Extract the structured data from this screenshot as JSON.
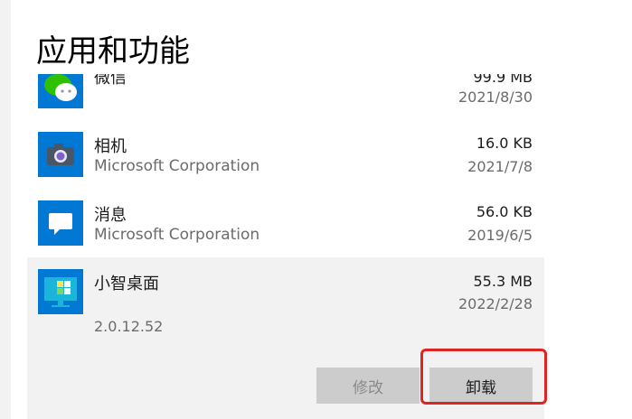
{
  "page": {
    "title": "应用和功能"
  },
  "apps": [
    {
      "name": "微信",
      "publisher": "",
      "size": "99.9 MB",
      "date": "2021/8/30",
      "icon": "wechat-icon"
    },
    {
      "name": "相机",
      "publisher": "Microsoft Corporation",
      "size": "16.0 KB",
      "date": "2021/7/8",
      "icon": "camera-icon"
    },
    {
      "name": "消息",
      "publisher": "Microsoft Corporation",
      "size": "56.0 KB",
      "date": "2019/6/5",
      "icon": "message-icon"
    },
    {
      "name": "小智桌面",
      "version": "2.0.12.52",
      "size": "55.3 MB",
      "date": "2022/2/28",
      "icon": "xiaozhi-desktop-icon"
    }
  ],
  "actions": {
    "modify_label": "修改",
    "uninstall_label": "卸载"
  },
  "colors": {
    "accent": "#0078d4",
    "highlight": "#e02424",
    "selected_bg": "#f2f2f2"
  }
}
